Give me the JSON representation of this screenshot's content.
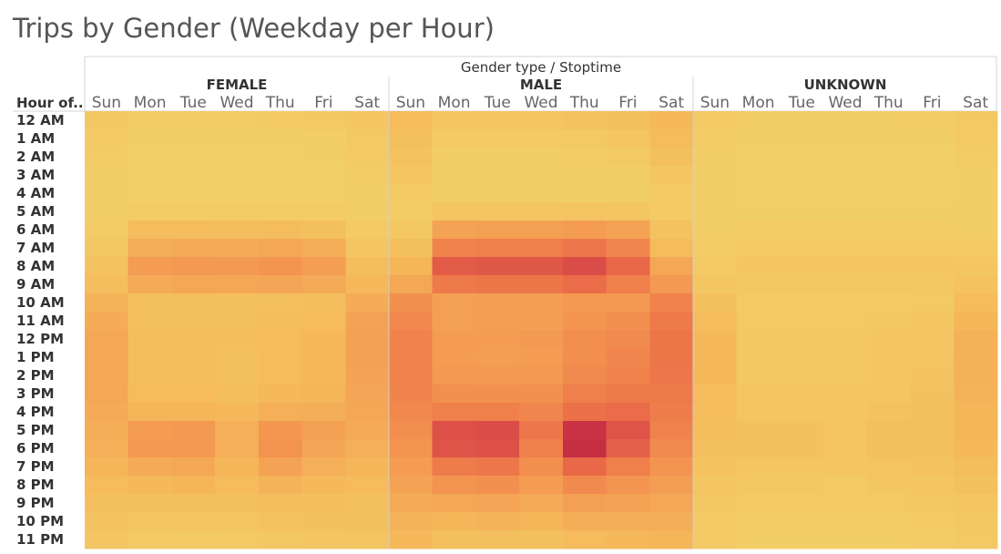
{
  "title": "Trips by Gender (Weekday per Hour)",
  "chart_data": {
    "type": "heatmap",
    "title": "Trips by Gender (Weekday per Hour)",
    "column_header": "Gender type / Stoptime",
    "row_header": "Hour of..",
    "groups": [
      "FEMALE",
      "MALE",
      "UNKNOWN"
    ],
    "days": [
      "Sun",
      "Mon",
      "Tue",
      "Wed",
      "Thu",
      "Fri",
      "Sat"
    ],
    "hours": [
      "12 AM",
      "1 AM",
      "2 AM",
      "3 AM",
      "4 AM",
      "5 AM",
      "6 AM",
      "7 AM",
      "8 AM",
      "9 AM",
      "10 AM",
      "11 AM",
      "12 PM",
      "1 PM",
      "2 PM",
      "3 PM",
      "4 PM",
      "5 PM",
      "6 PM",
      "7 PM",
      "8 PM",
      "9 PM",
      "10 PM",
      "11 PM"
    ],
    "color_scale": [
      "#f2d26b",
      "#f5b85a",
      "#f39550",
      "#ec7048",
      "#d84848",
      "#b81c40"
    ],
    "intensity_range": [
      0,
      1
    ],
    "values": {
      "FEMALE": [
        [
          0.08,
          0.05,
          0.05,
          0.05,
          0.06,
          0.07,
          0.1
        ],
        [
          0.06,
          0.03,
          0.03,
          0.03,
          0.03,
          0.04,
          0.07
        ],
        [
          0.05,
          0.02,
          0.02,
          0.02,
          0.02,
          0.03,
          0.06
        ],
        [
          0.04,
          0.02,
          0.02,
          0.02,
          0.02,
          0.02,
          0.05
        ],
        [
          0.03,
          0.02,
          0.02,
          0.02,
          0.02,
          0.02,
          0.03
        ],
        [
          0.04,
          0.05,
          0.05,
          0.05,
          0.05,
          0.05,
          0.04
        ],
        [
          0.05,
          0.17,
          0.17,
          0.16,
          0.17,
          0.15,
          0.06
        ],
        [
          0.08,
          0.26,
          0.28,
          0.27,
          0.29,
          0.26,
          0.1
        ],
        [
          0.12,
          0.36,
          0.38,
          0.37,
          0.4,
          0.35,
          0.16
        ],
        [
          0.16,
          0.28,
          0.3,
          0.29,
          0.31,
          0.28,
          0.2
        ],
        [
          0.23,
          0.14,
          0.15,
          0.14,
          0.15,
          0.16,
          0.27
        ],
        [
          0.27,
          0.14,
          0.15,
          0.15,
          0.16,
          0.18,
          0.32
        ],
        [
          0.3,
          0.16,
          0.16,
          0.16,
          0.18,
          0.2,
          0.33
        ],
        [
          0.3,
          0.16,
          0.16,
          0.15,
          0.18,
          0.2,
          0.33
        ],
        [
          0.3,
          0.16,
          0.16,
          0.15,
          0.18,
          0.2,
          0.32
        ],
        [
          0.29,
          0.18,
          0.18,
          0.16,
          0.2,
          0.22,
          0.31
        ],
        [
          0.28,
          0.22,
          0.22,
          0.2,
          0.25,
          0.26,
          0.3
        ],
        [
          0.26,
          0.36,
          0.37,
          0.25,
          0.39,
          0.33,
          0.28
        ],
        [
          0.25,
          0.38,
          0.38,
          0.25,
          0.41,
          0.31,
          0.25
        ],
        [
          0.22,
          0.28,
          0.29,
          0.22,
          0.32,
          0.25,
          0.22
        ],
        [
          0.18,
          0.2,
          0.21,
          0.18,
          0.23,
          0.19,
          0.18
        ],
        [
          0.14,
          0.14,
          0.15,
          0.14,
          0.16,
          0.16,
          0.15
        ],
        [
          0.12,
          0.1,
          0.11,
          0.1,
          0.12,
          0.13,
          0.13
        ],
        [
          0.1,
          0.07,
          0.07,
          0.07,
          0.08,
          0.1,
          0.11
        ]
      ],
      "MALE": [
        [
          0.18,
          0.1,
          0.1,
          0.1,
          0.12,
          0.14,
          0.2
        ],
        [
          0.15,
          0.06,
          0.06,
          0.06,
          0.07,
          0.09,
          0.17
        ],
        [
          0.12,
          0.04,
          0.04,
          0.04,
          0.05,
          0.06,
          0.14
        ],
        [
          0.09,
          0.03,
          0.03,
          0.03,
          0.04,
          0.04,
          0.1
        ],
        [
          0.06,
          0.03,
          0.03,
          0.03,
          0.03,
          0.03,
          0.06
        ],
        [
          0.05,
          0.1,
          0.1,
          0.1,
          0.11,
          0.1,
          0.06
        ],
        [
          0.08,
          0.32,
          0.34,
          0.34,
          0.36,
          0.32,
          0.12
        ],
        [
          0.14,
          0.5,
          0.52,
          0.52,
          0.56,
          0.48,
          0.18
        ],
        [
          0.22,
          0.7,
          0.72,
          0.72,
          0.78,
          0.64,
          0.3
        ],
        [
          0.3,
          0.55,
          0.57,
          0.57,
          0.62,
          0.52,
          0.38
        ],
        [
          0.42,
          0.34,
          0.35,
          0.35,
          0.38,
          0.38,
          0.5
        ],
        [
          0.47,
          0.34,
          0.35,
          0.35,
          0.4,
          0.42,
          0.55
        ],
        [
          0.5,
          0.36,
          0.36,
          0.37,
          0.44,
          0.46,
          0.57
        ],
        [
          0.5,
          0.36,
          0.35,
          0.36,
          0.44,
          0.48,
          0.57
        ],
        [
          0.5,
          0.38,
          0.37,
          0.38,
          0.46,
          0.5,
          0.56
        ],
        [
          0.49,
          0.42,
          0.42,
          0.42,
          0.52,
          0.55,
          0.55
        ],
        [
          0.47,
          0.52,
          0.52,
          0.48,
          0.6,
          0.62,
          0.53
        ],
        [
          0.44,
          0.76,
          0.78,
          0.56,
          0.9,
          0.74,
          0.5
        ],
        [
          0.4,
          0.74,
          0.76,
          0.52,
          0.92,
          0.68,
          0.46
        ],
        [
          0.36,
          0.54,
          0.56,
          0.44,
          0.64,
          0.52,
          0.4
        ],
        [
          0.32,
          0.4,
          0.42,
          0.36,
          0.46,
          0.4,
          0.35
        ],
        [
          0.27,
          0.3,
          0.31,
          0.28,
          0.34,
          0.32,
          0.3
        ],
        [
          0.23,
          0.22,
          0.23,
          0.22,
          0.26,
          0.26,
          0.26
        ],
        [
          0.19,
          0.15,
          0.15,
          0.15,
          0.18,
          0.2,
          0.22
        ]
      ],
      "UNKNOWN": [
        [
          0.06,
          0.04,
          0.04,
          0.04,
          0.04,
          0.05,
          0.07
        ],
        [
          0.05,
          0.03,
          0.03,
          0.03,
          0.03,
          0.03,
          0.06
        ],
        [
          0.04,
          0.02,
          0.02,
          0.02,
          0.02,
          0.02,
          0.05
        ],
        [
          0.03,
          0.02,
          0.02,
          0.02,
          0.02,
          0.02,
          0.04
        ],
        [
          0.03,
          0.02,
          0.02,
          0.02,
          0.02,
          0.02,
          0.03
        ],
        [
          0.03,
          0.03,
          0.03,
          0.03,
          0.03,
          0.03,
          0.03
        ],
        [
          0.04,
          0.05,
          0.05,
          0.05,
          0.05,
          0.05,
          0.04
        ],
        [
          0.05,
          0.07,
          0.07,
          0.07,
          0.07,
          0.07,
          0.06
        ],
        [
          0.07,
          0.09,
          0.09,
          0.09,
          0.09,
          0.09,
          0.09
        ],
        [
          0.1,
          0.08,
          0.08,
          0.08,
          0.08,
          0.08,
          0.12
        ],
        [
          0.14,
          0.06,
          0.06,
          0.06,
          0.06,
          0.07,
          0.18
        ],
        [
          0.17,
          0.07,
          0.07,
          0.07,
          0.08,
          0.09,
          0.22
        ],
        [
          0.19,
          0.08,
          0.08,
          0.08,
          0.09,
          0.1,
          0.24
        ],
        [
          0.19,
          0.08,
          0.08,
          0.08,
          0.09,
          0.11,
          0.24
        ],
        [
          0.19,
          0.08,
          0.08,
          0.08,
          0.1,
          0.12,
          0.24
        ],
        [
          0.18,
          0.09,
          0.09,
          0.09,
          0.1,
          0.13,
          0.23
        ],
        [
          0.17,
          0.1,
          0.1,
          0.1,
          0.12,
          0.14,
          0.22
        ],
        [
          0.16,
          0.13,
          0.13,
          0.11,
          0.14,
          0.15,
          0.21
        ],
        [
          0.14,
          0.13,
          0.13,
          0.11,
          0.14,
          0.14,
          0.19
        ],
        [
          0.12,
          0.1,
          0.1,
          0.09,
          0.11,
          0.12,
          0.16
        ],
        [
          0.1,
          0.08,
          0.08,
          0.07,
          0.09,
          0.1,
          0.13
        ],
        [
          0.08,
          0.06,
          0.06,
          0.06,
          0.07,
          0.08,
          0.1
        ],
        [
          0.07,
          0.05,
          0.05,
          0.05,
          0.05,
          0.06,
          0.08
        ],
        [
          0.06,
          0.04,
          0.04,
          0.04,
          0.04,
          0.05,
          0.07
        ]
      ]
    }
  }
}
